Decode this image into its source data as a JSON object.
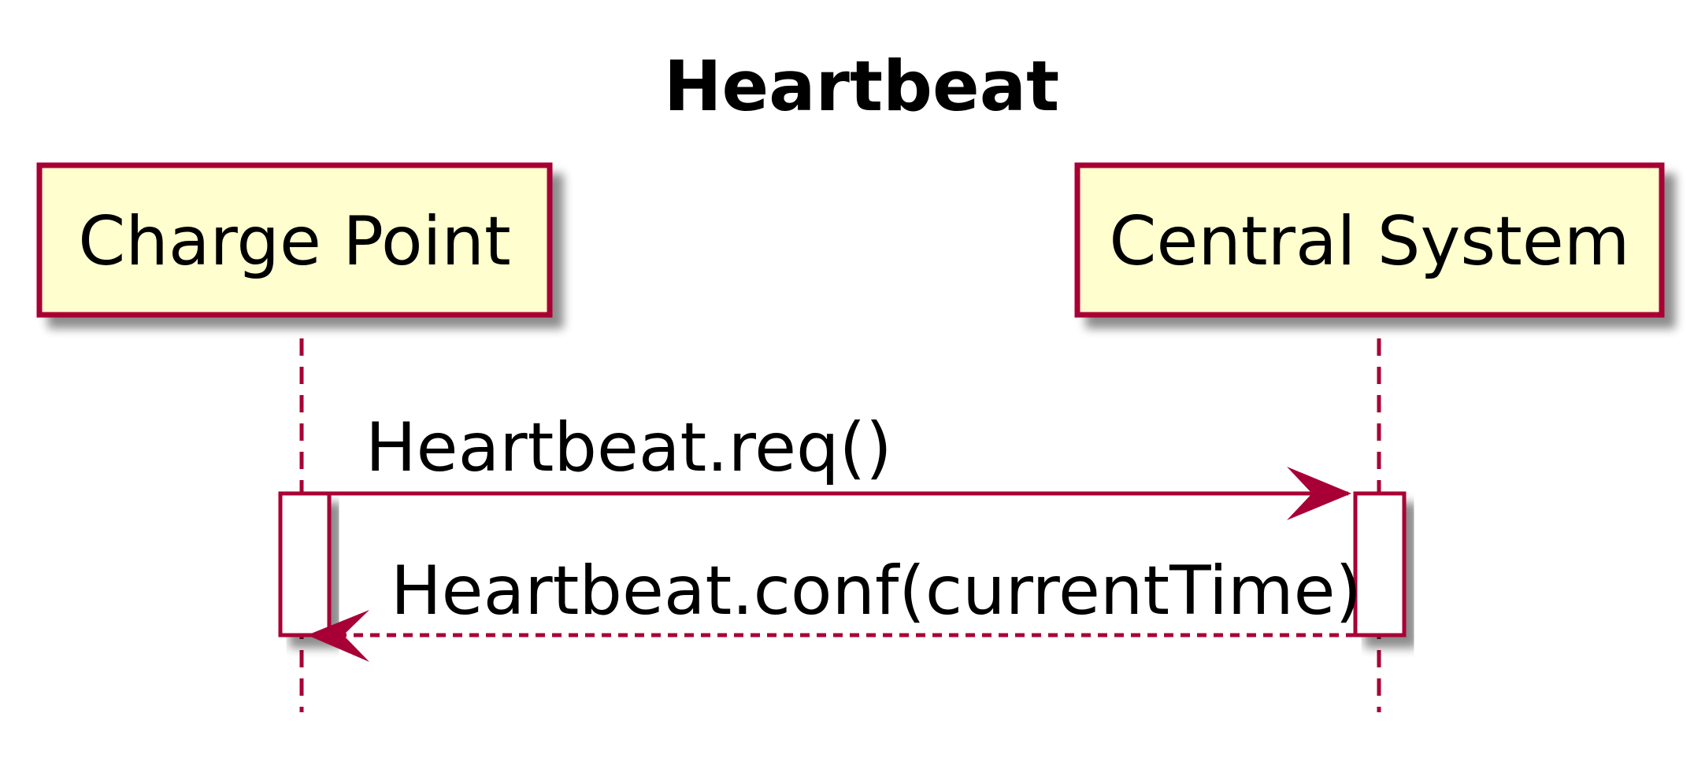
{
  "title": "Heartbeat",
  "colors": {
    "border": "#A80036",
    "participant_fill": "#FEFECE",
    "activation_fill": "#FFFFFF",
    "shadow": "#9a9a9a",
    "text": "#000000"
  },
  "participants": [
    {
      "id": "charge_point",
      "label": "Charge Point"
    },
    {
      "id": "central_system",
      "label": "Central System"
    }
  ],
  "messages": [
    {
      "from": "charge_point",
      "to": "central_system",
      "label": "Heartbeat.req()",
      "style": "solid"
    },
    {
      "from": "central_system",
      "to": "charge_point",
      "label": "Heartbeat.conf(currentTime)",
      "style": "dashed"
    }
  ]
}
